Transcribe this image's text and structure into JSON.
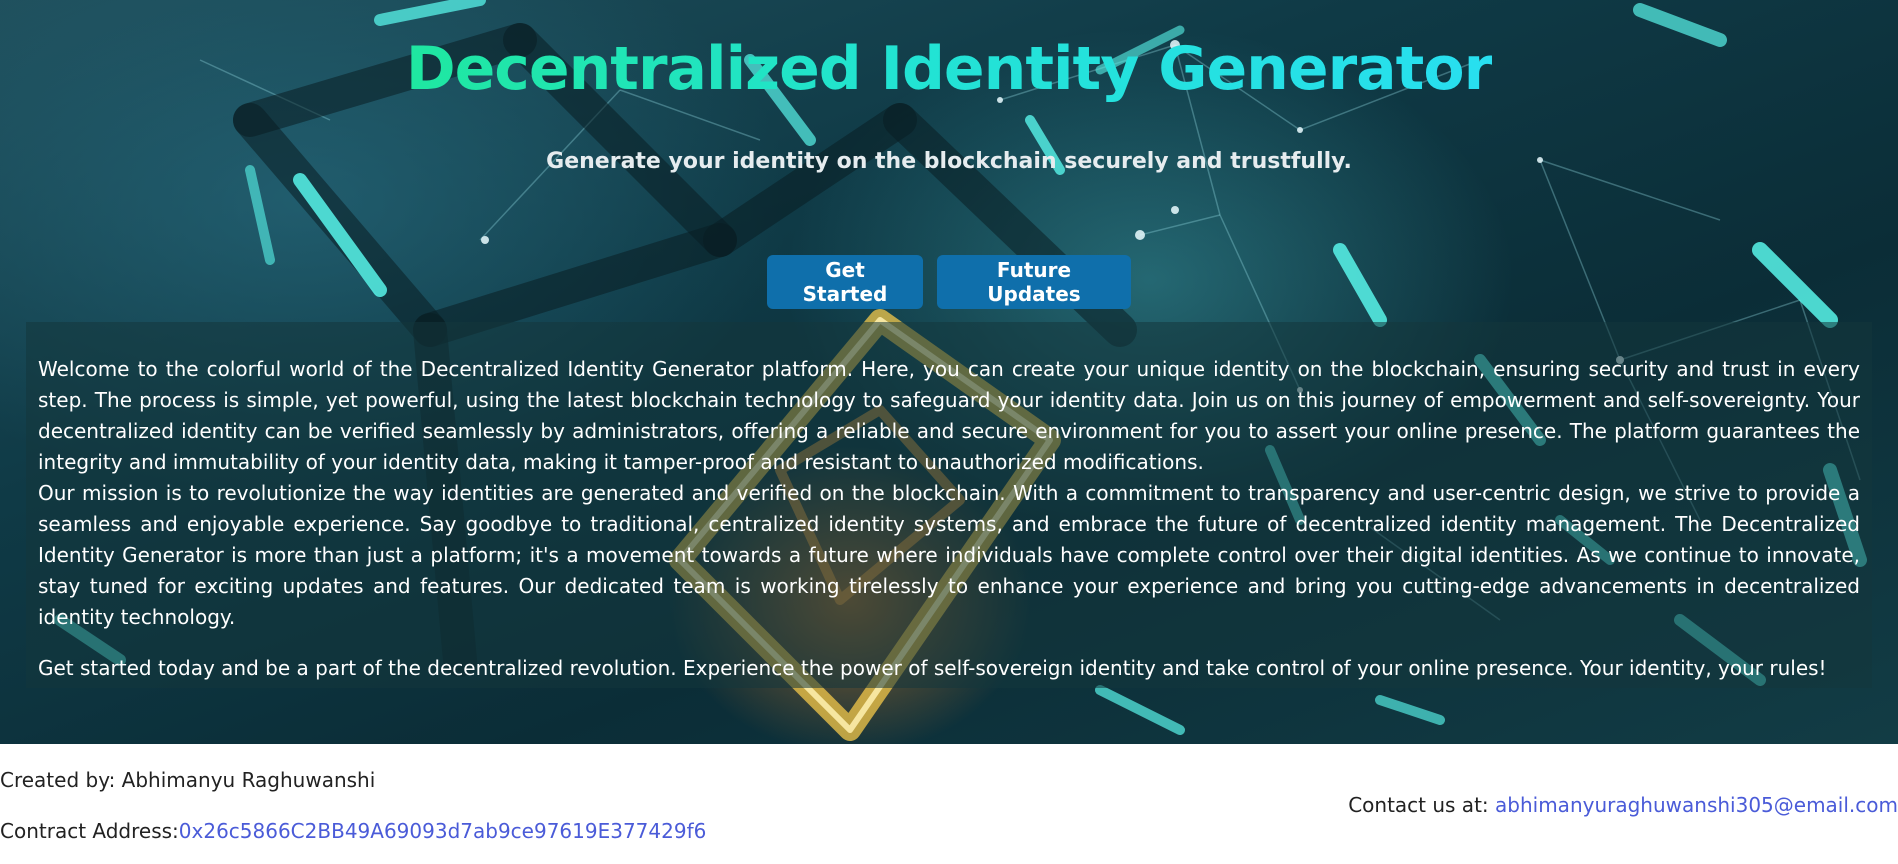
{
  "hero": {
    "title": "Decentralized Identity Generator",
    "subtitle": "Generate your identity on the blockchain securely and trustfully.",
    "buttons": {
      "get_started": "Get Started",
      "future_updates": "Future Updates"
    }
  },
  "content": {
    "paragraph1": "Welcome to the colorful world of the Decentralized Identity Generator platform. Here, you can create your unique identity on the blockchain, ensuring security and trust in every step. The process is simple, yet powerful, using the latest blockchain technology to safeguard your identity data. Join us on this journey of empowerment and self-sovereignty. Your decentralized identity can be verified seamlessly by administrators, offering a reliable and secure environment for you to assert your online presence. The platform guarantees the integrity and immutability of your identity data, making it tamper-proof and resistant to unauthorized modifications.",
    "paragraph2": "Our mission is to revolutionize the way identities are generated and verified on the blockchain. With a commitment to transparency and user-centric design, we strive to provide a seamless and enjoyable experience. Say goodbye to traditional, centralized identity systems, and embrace the future of decentralized identity management. The Decentralized Identity Generator is more than just a platform; it's a movement towards a future where individuals have complete control over their digital identities. As we continue to innovate, stay tuned for exciting updates and features. Our dedicated team is working tirelessly to enhance your experience and bring you cutting-edge advancements in decentralized identity technology.",
    "paragraph3": "Get started today and be a part of the decentralized revolution. Experience the power of self-sovereign identity and take control of your online presence. Your identity, your rules!"
  },
  "footer": {
    "created_by": "Created by: Abhimanyu Raghuwanshi",
    "contract_label": "Contract Address:",
    "contract_address": "0x26c5866C2BB49A69093d7ab9ce97619E377429f6",
    "contact_label": "Contact us at: ",
    "contact_email": "abhimanyuraghuwanshi305@email.com"
  },
  "colors": {
    "title_gradient_start": "#1fe7a0",
    "title_gradient_end": "#28dff0",
    "button_bg": "#0f6fab",
    "link": "#4a5bd8"
  }
}
